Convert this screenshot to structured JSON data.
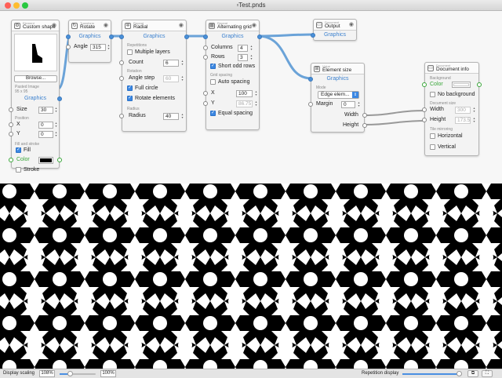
{
  "window": {
    "title": "Test.pnds",
    "file_icon": "document-icon"
  },
  "colors": {
    "wire": "#6ba3d8",
    "accent": "#3b87e2",
    "close": "#ff5f57",
    "minimize": "#febc2e",
    "maximize": "#28c840",
    "port_green": "#37a637"
  },
  "nodes": {
    "custom_shape": {
      "category": "Element",
      "name": "Custom shape",
      "browse": "Browse...",
      "pasted": "Pasted Image",
      "pasted_size": "95 x 95",
      "out": "Graphics",
      "size_label": "Size",
      "size": "30",
      "position": "Position",
      "x_label": "X",
      "x": "0",
      "y_label": "Y",
      "y": "0",
      "fill_stroke": "Fill and stroke",
      "fill": "Fill",
      "color_label": "Color",
      "color": "#000000",
      "stroke": "Stroke"
    },
    "rotate": {
      "category": "Transform",
      "name": "Rotate",
      "in": "Graphics",
      "angle_label": "Angle",
      "angle": "315"
    },
    "radial": {
      "category": "Repeat",
      "name": "Radial",
      "in": "Graphics",
      "repetitions": "Repetitions",
      "multiple_layers": "Multiple layers",
      "count_label": "Count",
      "count": "6",
      "rotation": "Rotation",
      "angle_step_label": "Angle step",
      "angle_step": "60",
      "full_circle": "Full circle",
      "rotate_elements": "Rotate elements",
      "radius_sec": "Radius",
      "radius_label": "Radius",
      "radius": "40"
    },
    "grid": {
      "category": "Repeat",
      "name": "Alternating grid",
      "in": "Graphics",
      "columns_label": "Columns",
      "columns": "4",
      "rows_label": "Rows",
      "rows": "3",
      "short_odd_rows": "Short odd rows",
      "grid_spacing": "Grid spacing",
      "auto_spacing": "Auto spacing",
      "x_label": "X",
      "x": "100",
      "y_label": "Y",
      "y": "86.75",
      "equal_spacing": "Equal spacing"
    },
    "output": {
      "category": "Document",
      "name": "Output",
      "in": "Graphics"
    },
    "element_size": {
      "category": "Value",
      "name": "Element size",
      "in": "Graphics",
      "mode": "Mode",
      "mode_value": "Edge elem...",
      "margin_label": "Margin",
      "margin": "0",
      "width": "Width",
      "height": "Height"
    },
    "doc_info": {
      "category": "Document",
      "name": "Document info",
      "background": "Background",
      "color_label": "Color",
      "color": "#ffffff",
      "no_background": "No background",
      "doc_size": "Document size",
      "width_label": "Width",
      "width": "300",
      "height_label": "Height",
      "height": "173.5",
      "tile_mirroring": "Tile mirroring",
      "horizontal": "Horizontal",
      "vertical": "Vertical"
    }
  },
  "statusbar": {
    "display_scaling_label": "Display scaling",
    "scale_value": "108%",
    "slider_value": "100%",
    "repetition_display_label": "Repetition display",
    "display_scaling_fraction": 0.3,
    "repetition_fraction": 0.95
  }
}
